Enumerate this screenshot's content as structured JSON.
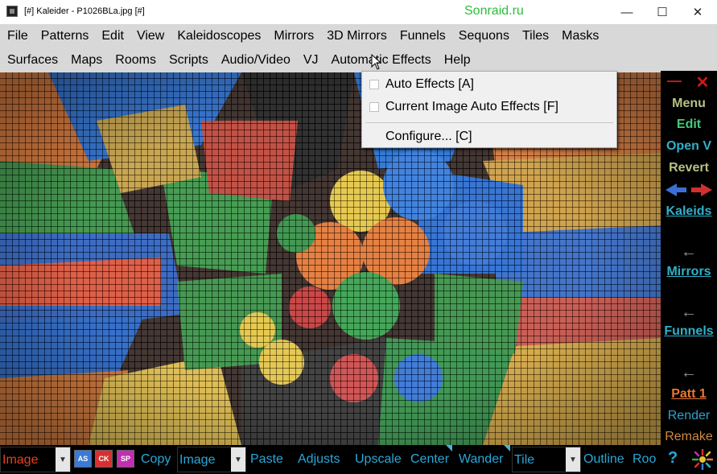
{
  "window": {
    "title": "[#] Kaleider - P1026BLa.jpg [#]",
    "watermark": "Sonraid.ru",
    "minimize": "—",
    "maximize": "☐",
    "close": "✕"
  },
  "menubar1": [
    "File",
    "Patterns",
    "Edit",
    "View",
    "Kaleidoscopes",
    "Mirrors",
    "3D Mirrors",
    "Funnels",
    "Sequons",
    "Tiles",
    "Masks"
  ],
  "menubar2": [
    "Surfaces",
    "Maps",
    "Rooms",
    "Scripts",
    "Audio/Video",
    "VJ",
    "Automatic Effects",
    "Help"
  ],
  "dropdown": {
    "items": [
      {
        "label": "Auto Effects  [A]"
      },
      {
        "label": "Current Image Auto Effects  [F]"
      },
      {
        "label": "Configure...  [C]"
      }
    ]
  },
  "side_panel": {
    "minimize": "—",
    "close": "✕",
    "menu": "Menu",
    "edit": "Edit",
    "open_v": "Open V",
    "revert": "Revert",
    "kaleids": "Kaleids",
    "mirrors": "Mirrors",
    "funnels": "Funnels",
    "patt": "Patt 1",
    "render": "Render",
    "remake": "Remake",
    "colors": {
      "red": "#d01818",
      "olive": "#b8c080",
      "teal": "#30b0c8",
      "green": "#48c878",
      "orange": "#e87830",
      "grey": "#909090"
    }
  },
  "bottom_bar": {
    "combo1": "Image",
    "mini_buttons": [
      "AS",
      "CK",
      "SP"
    ],
    "copy": "Copy",
    "combo2": "Image",
    "paste": "Paste",
    "adjusts": "Adjusts",
    "upscale": "Upscale",
    "center": "Center",
    "wander": "Wander",
    "combo3": "Tile",
    "outline": "Outline",
    "roo": "Roo",
    "help": "?"
  }
}
